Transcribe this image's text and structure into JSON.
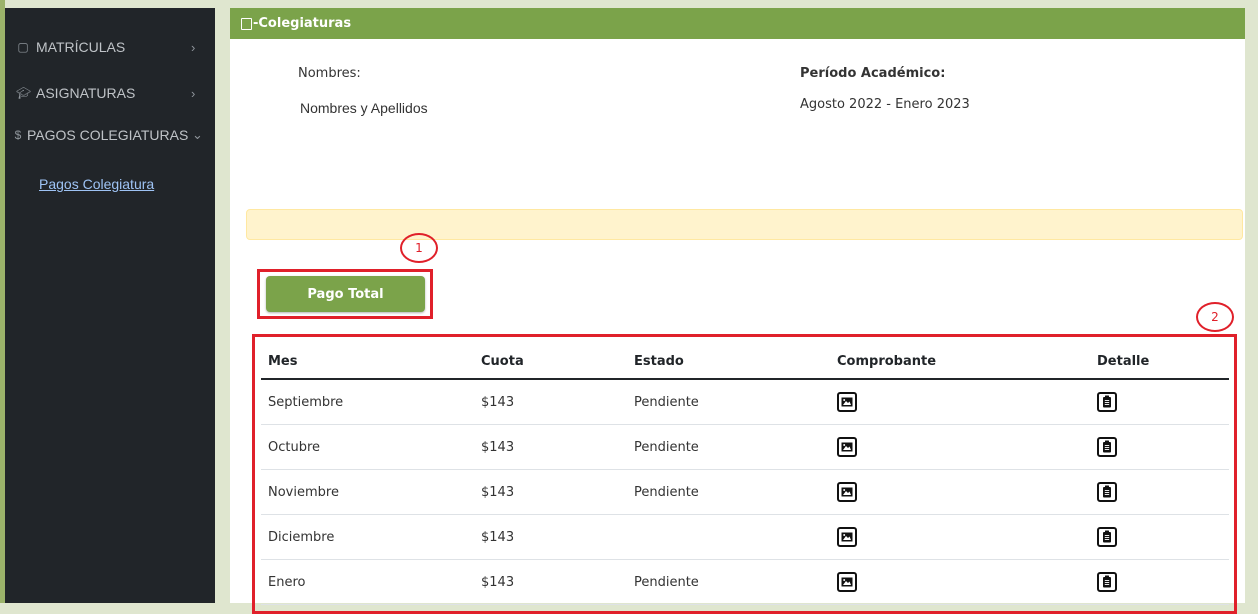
{
  "sidebar": {
    "items": [
      {
        "label": "MATRÍCULAS",
        "icon": "book-icon"
      },
      {
        "label": "ASIGNATURAS",
        "icon": "graduation-cap-icon"
      },
      {
        "label": "PAGOS COLEGIATURAS",
        "icon": "dollar-icon"
      }
    ],
    "subitem": "Pagos Colegiatura"
  },
  "panel": {
    "title": "-Colegiaturas",
    "nombres_label": "Nombres:",
    "nombres_value": "Nombres y Apellidos",
    "periodo_label": "Período Académico:",
    "periodo_value": "Agosto 2022 - Enero 2023"
  },
  "button": {
    "pago_total": "Pago Total"
  },
  "callouts": [
    "1",
    "2"
  ],
  "table": {
    "headers": [
      "Mes",
      "Cuota",
      "Estado",
      "Comprobante",
      "Detalle"
    ],
    "rows": [
      {
        "mes": "Septiembre",
        "cuota": "$143",
        "estado": "Pendiente"
      },
      {
        "mes": "Octubre",
        "cuota": "$143",
        "estado": "Pendiente"
      },
      {
        "mes": "Noviembre",
        "cuota": "$143",
        "estado": "Pendiente"
      },
      {
        "mes": "Diciembre",
        "cuota": "$143",
        "estado": ""
      },
      {
        "mes": "Enero",
        "cuota": "$143",
        "estado": "Pendiente"
      }
    ]
  },
  "colors": {
    "accent": "#7ba34a",
    "annotation": "#e0202a",
    "sidebar": "#212529",
    "alert": "#fff3cd"
  }
}
